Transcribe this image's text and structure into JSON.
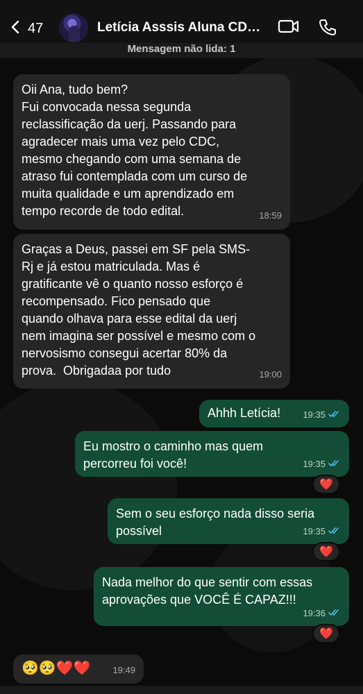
{
  "header": {
    "back_count": "47",
    "contact_name": "Letícia Asssis Aluna CDC..."
  },
  "unread_banner": "Mensagem não lida: 1",
  "messages": [
    {
      "text": "Oii Ana, tudo bem?\nFui convocada nessa segunda\nreclassificação da uerj. Passando para\nagradecer mais uma vez pelo CDC,\nmesmo chegando com uma semana de\natraso fui contemplada com um curso de\nmuita qualidade e um aprendizado em\ntempo recorde de todo edital.",
      "time": "18:59"
    },
    {
      "text": "Graças a Deus, passei em SF pela SMS-\nRj e já estou matriculada. Mas é\ngratificante vê o quanto nosso esforço é\nrecompensado. Fico pensado que\nquando olhava para esse edital da uerj\nnem imagina ser possível e mesmo com o\nnervosismo consegui acertar 80% da\nprova.  Obrigadaa por tudo",
      "time": "19:00"
    },
    {
      "text": "Ahhh Letícia!",
      "time": "19:35"
    },
    {
      "text": "Eu mostro o caminho mas quem\npercorreu foi você!",
      "time": "19:35",
      "reaction": "❤️"
    },
    {
      "text": "Sem o seu esforço nada disso seria\npossível",
      "time": "19:35",
      "reaction": "❤️"
    },
    {
      "text": "Nada melhor do que sentir com essas\naprovações que VOCÊ É CAPAZ!!!",
      "time": "19:36",
      "reaction": "❤️"
    },
    {
      "text": "🥺🥺❤️❤️",
      "time": "19:49"
    }
  ],
  "colors": {
    "incoming_bubble": "#262626",
    "outgoing_bubble": "#134d37",
    "read_ticks": "#53bdeb"
  }
}
